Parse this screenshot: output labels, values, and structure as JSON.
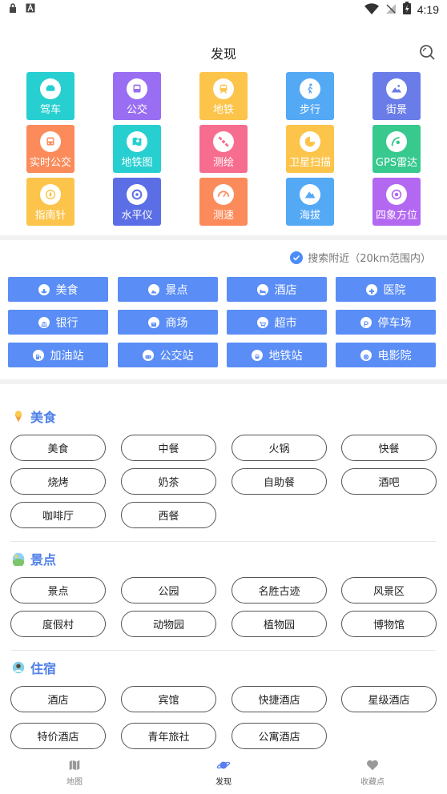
{
  "status_bar": {
    "time": "4:19"
  },
  "header": {
    "title": "发现"
  },
  "tools": [
    {
      "label": "驾车",
      "color": "#27cfd0",
      "icon": "car-icon"
    },
    {
      "label": "公交",
      "color": "#9a6ef2",
      "icon": "bus-icon"
    },
    {
      "label": "地铁",
      "color": "#fcc44b",
      "icon": "subway-icon"
    },
    {
      "label": "步行",
      "color": "#54a9f5",
      "icon": "walk-icon"
    },
    {
      "label": "街景",
      "color": "#6a7ce8",
      "icon": "street-view-icon"
    },
    {
      "label": "实时公交",
      "color": "#fb8b5a",
      "icon": "realtime-bus-icon"
    },
    {
      "label": "地铁图",
      "color": "#27cfd0",
      "icon": "metro-map-icon"
    },
    {
      "label": "测绘",
      "color": "#f76d8f",
      "icon": "satellite-icon"
    },
    {
      "label": "卫星扫描",
      "color": "#fcc44b",
      "icon": "radar-scan-icon"
    },
    {
      "label": "GPS雷达",
      "color": "#37c98e",
      "icon": "gps-radar-icon"
    },
    {
      "label": "指南针",
      "color": "#fcc44b",
      "icon": "compass-icon"
    },
    {
      "label": "水平仪",
      "color": "#5c6ee6",
      "icon": "level-icon"
    },
    {
      "label": "测速",
      "color": "#fb8b5a",
      "icon": "speedometer-icon"
    },
    {
      "label": "海拔",
      "color": "#54a9f5",
      "icon": "mountain-icon"
    },
    {
      "label": "四象方位",
      "color": "#b368f2",
      "icon": "direction-icon"
    }
  ],
  "nearby": {
    "hint": "搜索附近（20km范围内）",
    "categories": [
      {
        "label": "美食",
        "icon": "food-icon"
      },
      {
        "label": "景点",
        "icon": "scenic-icon"
      },
      {
        "label": "酒店",
        "icon": "hotel-icon"
      },
      {
        "label": "医院",
        "icon": "hospital-icon"
      },
      {
        "label": "银行",
        "icon": "bank-icon"
      },
      {
        "label": "商场",
        "icon": "mall-icon"
      },
      {
        "label": "超市",
        "icon": "cart-icon"
      },
      {
        "label": "停车场",
        "icon": "parking-icon"
      },
      {
        "label": "加油站",
        "icon": "gas-station-icon"
      },
      {
        "label": "公交站",
        "icon": "bus-stop-icon"
      },
      {
        "label": "地铁站",
        "icon": "metro-station-icon"
      },
      {
        "label": "电影院",
        "icon": "cinema-icon"
      }
    ]
  },
  "sections": [
    {
      "title": "美食",
      "icon": "ice-cream-icon",
      "chips": [
        "美食",
        "中餐",
        "火锅",
        "快餐",
        "烧烤",
        "奶茶",
        "自助餐",
        "酒吧",
        "咖啡厅",
        "西餐"
      ]
    },
    {
      "title": "景点",
      "icon": "landscape-icon",
      "chips": [
        "景点",
        "公园",
        "名胜古迹",
        "风景区",
        "度假村",
        "动物园",
        "植物园",
        "博物馆"
      ]
    },
    {
      "title": "住宿",
      "icon": "lodging-icon",
      "chips": [
        "酒店",
        "宾馆",
        "快捷酒店",
        "星级酒店",
        "特价酒店",
        "青年旅社",
        "公寓酒店"
      ]
    }
  ],
  "bottom_nav": [
    {
      "label": "地图",
      "icon": "map-icon"
    },
    {
      "label": "发现",
      "icon": "planet-icon",
      "active": true
    },
    {
      "label": "收藏点",
      "icon": "heart-icon"
    }
  ]
}
